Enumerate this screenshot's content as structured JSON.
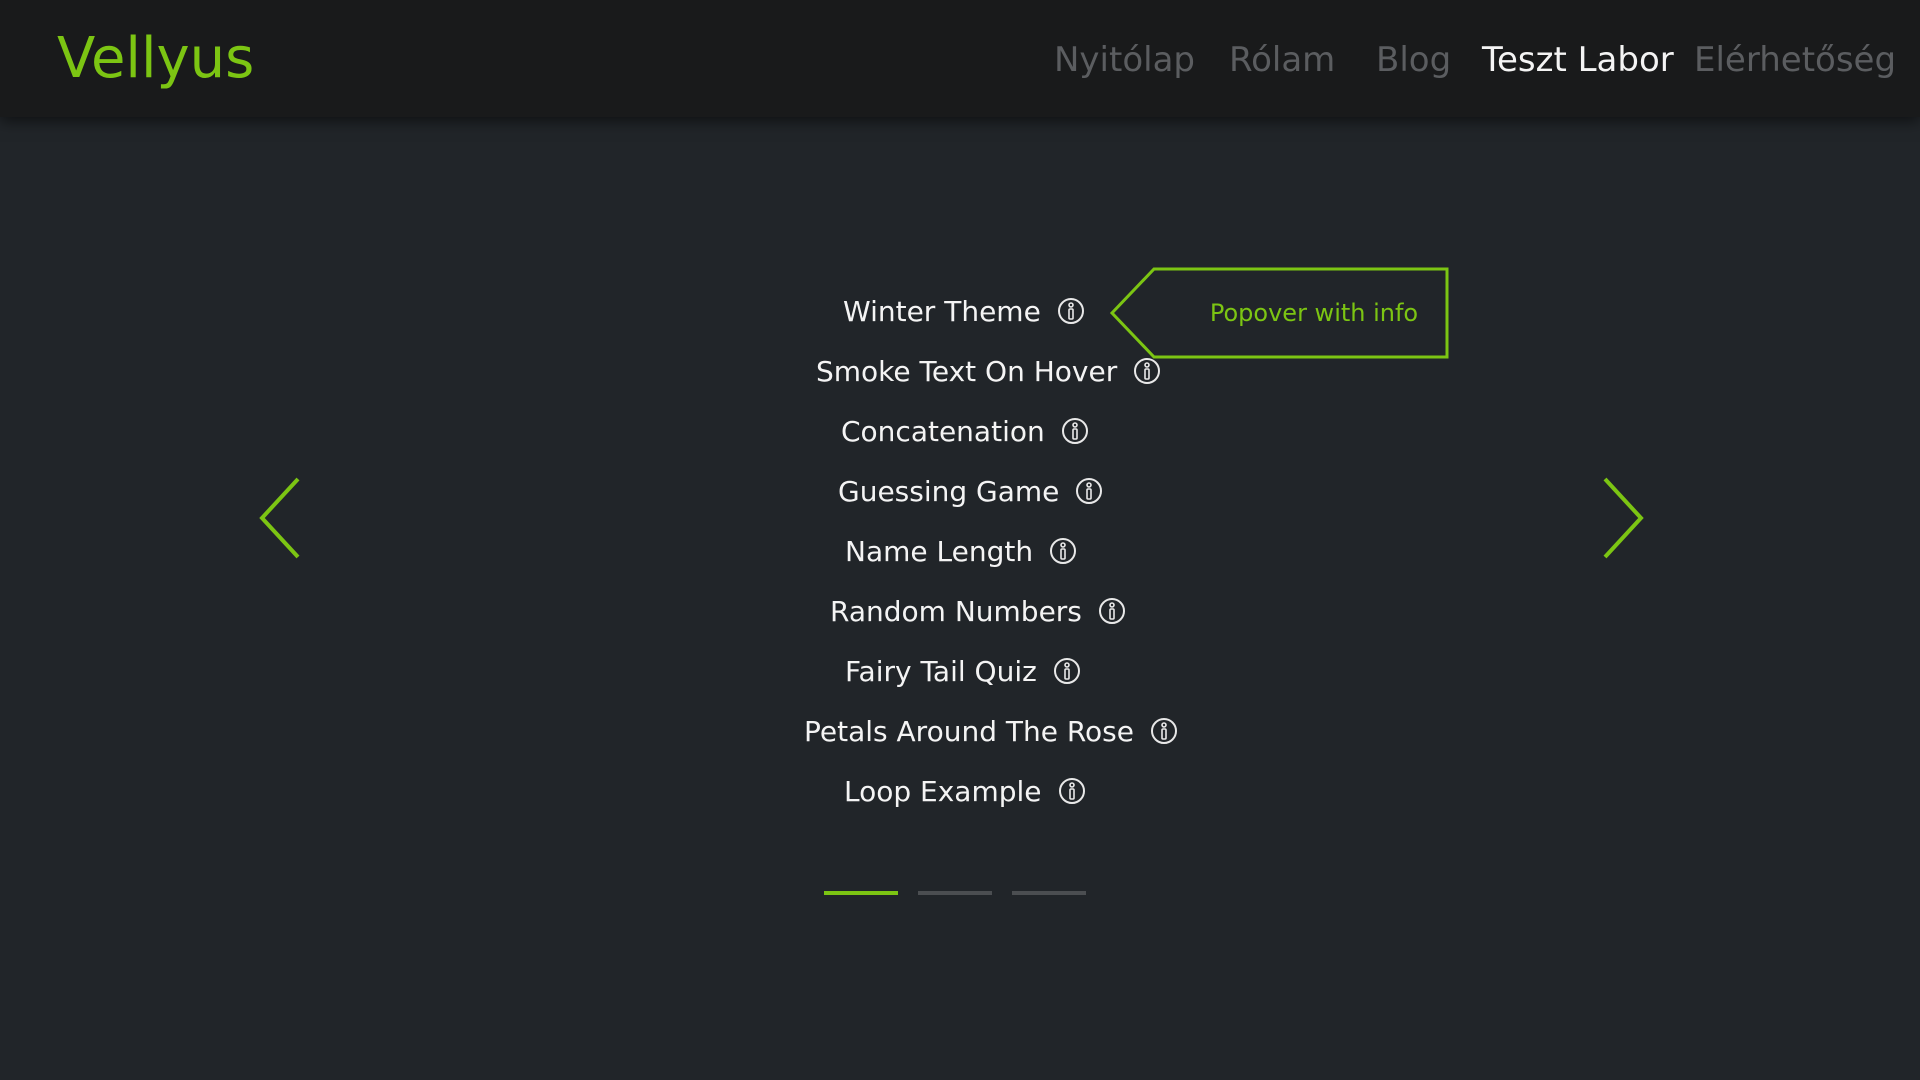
{
  "navbar": {
    "brand": "Vellyus",
    "items": [
      {
        "label": "Nyitólap"
      },
      {
        "label": "Rólam"
      },
      {
        "label": "Blog"
      },
      {
        "label": "Teszt Labor",
        "active": true
      },
      {
        "label": "Elérhetőség"
      }
    ]
  },
  "carousel": {
    "items": [
      {
        "label": "Winter Theme"
      },
      {
        "label": "Smoke Text On Hover"
      },
      {
        "label": "Concatenation"
      },
      {
        "label": "Guessing Game"
      },
      {
        "label": "Name Length"
      },
      {
        "label": "Random Numbers"
      },
      {
        "label": "Fairy Tail Quiz"
      },
      {
        "label": "Petals Around The Rose"
      },
      {
        "label": "Loop Example"
      }
    ],
    "popover": {
      "text": "Popover with info"
    },
    "indicators": [
      {
        "active": true
      },
      {
        "active": false
      },
      {
        "active": false
      }
    ],
    "prev_icon": "chevron-left-icon",
    "next_icon": "chevron-right-icon",
    "info_icon": "info-icon"
  },
  "colors": {
    "accent": "#7cc513",
    "background": "#212529",
    "navbar": "#191a1b",
    "nav_inactive": "#5b5d60",
    "text": "#f4f4f4"
  }
}
